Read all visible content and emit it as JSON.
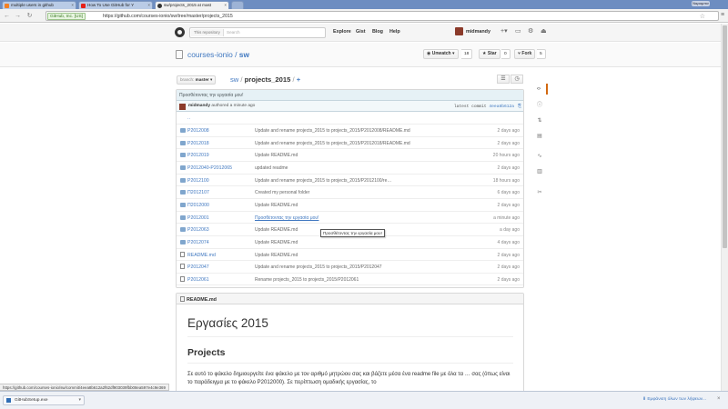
{
  "browser": {
    "tabs": [
      {
        "title": "multiple users in github",
        "icon_color": "#f48024",
        "active": false
      },
      {
        "title": "How To Use GitHub for Y",
        "icon_color": "#e62117",
        "active": false
      },
      {
        "title": "sw/projects_2015 at mast",
        "icon_color": "#333333",
        "active": true
      }
    ],
    "user_pill": "Ναραμπιν",
    "ssl_badge": "GitHub, Inc. [US]",
    "url": "https://github.com/courses-ionio/sw/tree/master/projects_2015"
  },
  "gh_header": {
    "search_scope": "This repository",
    "search_placeholder": "Search",
    "nav": [
      "Explore",
      "Gist",
      "Blog",
      "Help"
    ],
    "username": "midmandy"
  },
  "repo": {
    "owner": "courses-ionio",
    "separator": "/",
    "name": "sw",
    "unwatch_label": "Unwatch",
    "unwatch_count": "18",
    "star_label": "Star",
    "star_count": "0",
    "fork_label": "Fork",
    "fork_count": "5"
  },
  "filenav": {
    "branch_prefix": "branch:",
    "branch": "master",
    "root": "sw",
    "sep": "/",
    "folder": "projects_2015",
    "sep2": "/",
    "plus": "+"
  },
  "commit": {
    "message": "Προσθέτοντας την εργασία μου!",
    "author": "midmandy",
    "authored": "authored a minute ago",
    "latest_label": "latest commit",
    "sha": "4eea8b612a"
  },
  "up_dir": "..",
  "files": [
    {
      "type": "dir",
      "name": "P2012008",
      "message": "Update and rename projects_2015 to projects_2015/P2012008/README.md",
      "age": "2 days ago",
      "link": false
    },
    {
      "type": "dir",
      "name": "P2012018",
      "message": "Update and rename projects_2015 to projects_2015/P2012018/README.md",
      "age": "2 days ago",
      "link": false
    },
    {
      "type": "dir",
      "name": "P2012019",
      "message": "Update README.md",
      "age": "20 hours ago",
      "link": false
    },
    {
      "type": "dir",
      "name": "P2012040-P2012065",
      "message": "updated readme",
      "age": "2 days ago",
      "link": false
    },
    {
      "type": "dir",
      "name": "P2012100",
      "message": "Update and rename projects_2015 to projects_2015/P2012100/re…",
      "age": "18 hours ago",
      "link": false
    },
    {
      "type": "dir",
      "name": "Π2012107",
      "message": "Created my personal folder",
      "age": "6 days ago",
      "link": false
    },
    {
      "type": "dir",
      "name": "Π2012000",
      "message": "Update README.md",
      "age": "2 days ago",
      "link": false
    },
    {
      "type": "dir",
      "name": "P2012001",
      "message": "Προσθέτοντας την εργασία μου!",
      "age": "a minute ago",
      "link": true
    },
    {
      "type": "dir",
      "name": "P2012063",
      "message": "Update README.md",
      "age": "a day ago",
      "link": false
    },
    {
      "type": "dir",
      "name": "P2012074",
      "message": "Update README.md",
      "age": "4 days ago",
      "link": false
    },
    {
      "type": "file",
      "name": "README.md",
      "message": "Update README.md",
      "age": "2 days ago",
      "link": false
    },
    {
      "type": "file",
      "name": "P2012047",
      "message": "Update and rename projects_2015 to projects_2015/P2012047",
      "age": "2 days ago",
      "link": false
    },
    {
      "type": "file",
      "name": "P2012061",
      "message": "Rename projects_2015 to projects_2015/P2012061",
      "age": "2 days ago",
      "link": false
    }
  ],
  "tooltip": "Προσθέτοντας την εργασία μου!",
  "readme": {
    "filename": "README.md",
    "h1": "Εργασίες 2015",
    "h2": "Projects",
    "paragraph": "Σε αυτό το φάκελο δημιουργείτε ένα φάκελο με τον αριθμό μητρώου σας και βάζετε μέσα ένα readme file με όλα τα … σας (όπως είναι το παράδειγμα με το φάκελο P2012000). Σε περίπτωση ομαδικής εργασίας, το"
  },
  "status_url": "https://github.com/courses-ionio/sw/commit/4eea8b612a2f62df903039fbb08ea597e4c9e369",
  "downloads": {
    "item": "GitHubSetup.exe",
    "show_all": "Εμφάνιση όλων των λήψεων..."
  },
  "colors": {
    "link": "#4078c0",
    "accent_tab": "#d26911",
    "commit_bar": "#e6f1f6"
  }
}
